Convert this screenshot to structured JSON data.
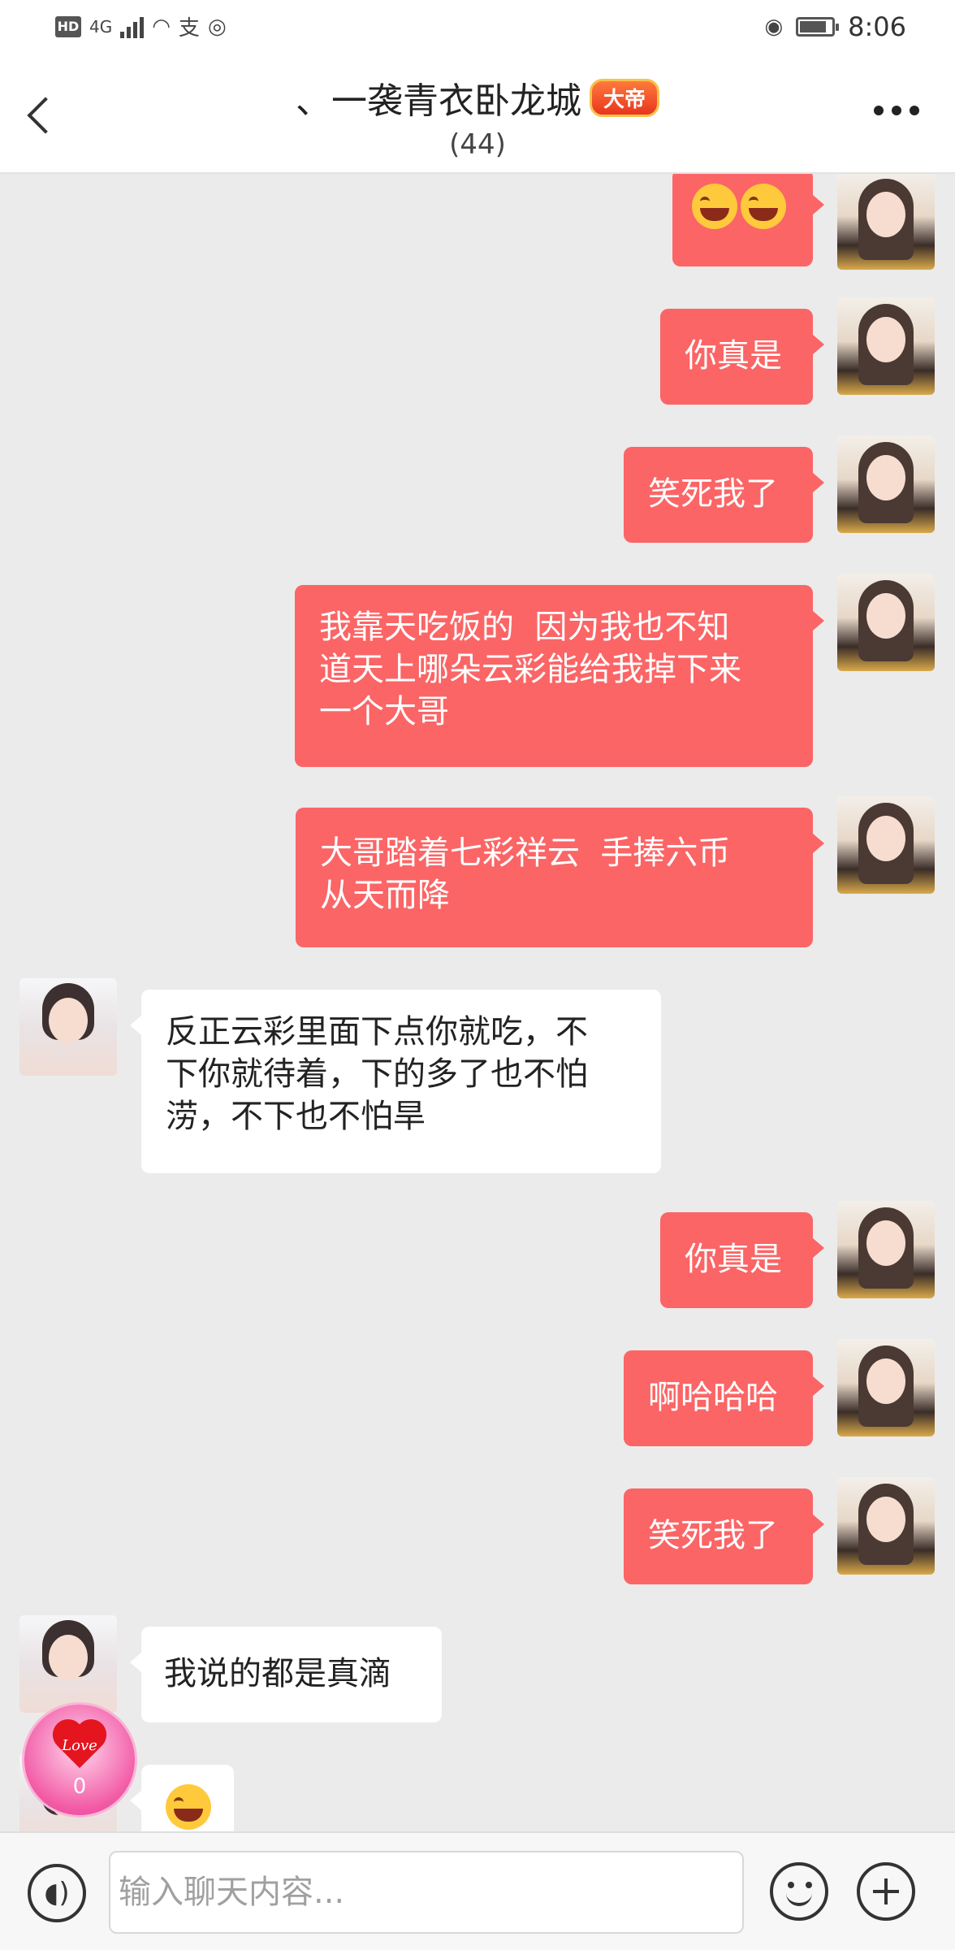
{
  "status_bar": {
    "hd": "HD",
    "signal": "4G",
    "app_icon": "支",
    "time": "8:06",
    "battery_level": 0.85
  },
  "header": {
    "title": "、一袭青衣卧龙城",
    "badge": "大帝",
    "member_count": "(44)"
  },
  "messages": [
    {
      "side": "me",
      "text": "",
      "emoji_count": 2
    },
    {
      "side": "me",
      "text": "你真是"
    },
    {
      "side": "me",
      "text": "笑死我了"
    },
    {
      "side": "me",
      "text": "我靠天吃饭的  因为我也不知\n道天上哪朵云彩能给我掉下来\n一个大哥"
    },
    {
      "side": "me",
      "text": "大哥踏着七彩祥云  手捧六币\n从天而降"
    },
    {
      "side": "other",
      "text": "反正云彩里面下点你就吃，不\n下你就待着，下的多了也不怕\n涝，不下也不怕旱"
    },
    {
      "side": "me",
      "text": "你真是"
    },
    {
      "side": "me",
      "text": "啊哈哈哈"
    },
    {
      "side": "me",
      "text": "笑死我了"
    },
    {
      "side": "other",
      "text": "我说的都是真滴"
    },
    {
      "side": "other",
      "text": "",
      "emoji_count": 1
    }
  ],
  "love_widget": {
    "label": "Love",
    "count": "0"
  },
  "input_bar": {
    "placeholder": "输入聊天内容..."
  }
}
